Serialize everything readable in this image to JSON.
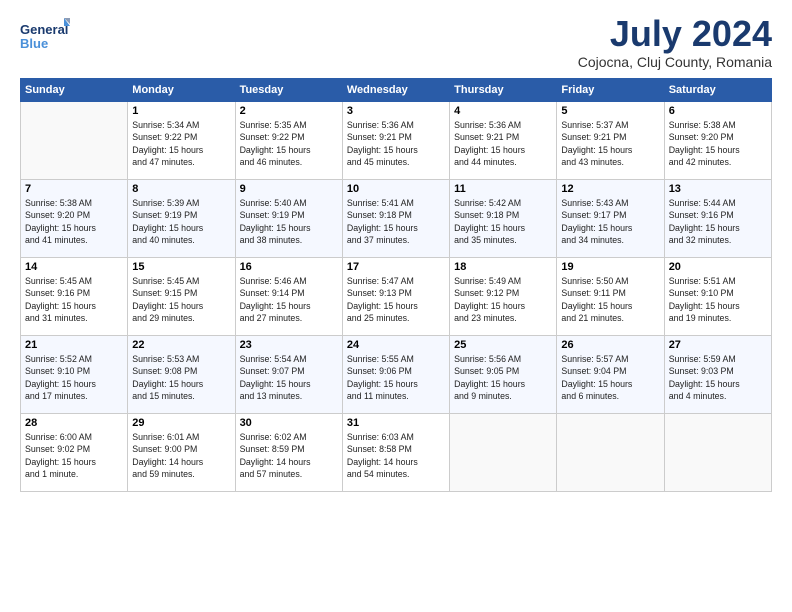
{
  "header": {
    "logo_general": "General",
    "logo_blue": "Blue",
    "month_title": "July 2024",
    "location": "Cojocna, Cluj County, Romania"
  },
  "days_of_week": [
    "Sunday",
    "Monday",
    "Tuesday",
    "Wednesday",
    "Thursday",
    "Friday",
    "Saturday"
  ],
  "weeks": [
    [
      {
        "day": "",
        "info": ""
      },
      {
        "day": "1",
        "info": "Sunrise: 5:34 AM\nSunset: 9:22 PM\nDaylight: 15 hours\nand 47 minutes."
      },
      {
        "day": "2",
        "info": "Sunrise: 5:35 AM\nSunset: 9:22 PM\nDaylight: 15 hours\nand 46 minutes."
      },
      {
        "day": "3",
        "info": "Sunrise: 5:36 AM\nSunset: 9:21 PM\nDaylight: 15 hours\nand 45 minutes."
      },
      {
        "day": "4",
        "info": "Sunrise: 5:36 AM\nSunset: 9:21 PM\nDaylight: 15 hours\nand 44 minutes."
      },
      {
        "day": "5",
        "info": "Sunrise: 5:37 AM\nSunset: 9:21 PM\nDaylight: 15 hours\nand 43 minutes."
      },
      {
        "day": "6",
        "info": "Sunrise: 5:38 AM\nSunset: 9:20 PM\nDaylight: 15 hours\nand 42 minutes."
      }
    ],
    [
      {
        "day": "7",
        "info": "Sunrise: 5:38 AM\nSunset: 9:20 PM\nDaylight: 15 hours\nand 41 minutes."
      },
      {
        "day": "8",
        "info": "Sunrise: 5:39 AM\nSunset: 9:19 PM\nDaylight: 15 hours\nand 40 minutes."
      },
      {
        "day": "9",
        "info": "Sunrise: 5:40 AM\nSunset: 9:19 PM\nDaylight: 15 hours\nand 38 minutes."
      },
      {
        "day": "10",
        "info": "Sunrise: 5:41 AM\nSunset: 9:18 PM\nDaylight: 15 hours\nand 37 minutes."
      },
      {
        "day": "11",
        "info": "Sunrise: 5:42 AM\nSunset: 9:18 PM\nDaylight: 15 hours\nand 35 minutes."
      },
      {
        "day": "12",
        "info": "Sunrise: 5:43 AM\nSunset: 9:17 PM\nDaylight: 15 hours\nand 34 minutes."
      },
      {
        "day": "13",
        "info": "Sunrise: 5:44 AM\nSunset: 9:16 PM\nDaylight: 15 hours\nand 32 minutes."
      }
    ],
    [
      {
        "day": "14",
        "info": "Sunrise: 5:45 AM\nSunset: 9:16 PM\nDaylight: 15 hours\nand 31 minutes."
      },
      {
        "day": "15",
        "info": "Sunrise: 5:45 AM\nSunset: 9:15 PM\nDaylight: 15 hours\nand 29 minutes."
      },
      {
        "day": "16",
        "info": "Sunrise: 5:46 AM\nSunset: 9:14 PM\nDaylight: 15 hours\nand 27 minutes."
      },
      {
        "day": "17",
        "info": "Sunrise: 5:47 AM\nSunset: 9:13 PM\nDaylight: 15 hours\nand 25 minutes."
      },
      {
        "day": "18",
        "info": "Sunrise: 5:49 AM\nSunset: 9:12 PM\nDaylight: 15 hours\nand 23 minutes."
      },
      {
        "day": "19",
        "info": "Sunrise: 5:50 AM\nSunset: 9:11 PM\nDaylight: 15 hours\nand 21 minutes."
      },
      {
        "day": "20",
        "info": "Sunrise: 5:51 AM\nSunset: 9:10 PM\nDaylight: 15 hours\nand 19 minutes."
      }
    ],
    [
      {
        "day": "21",
        "info": "Sunrise: 5:52 AM\nSunset: 9:10 PM\nDaylight: 15 hours\nand 17 minutes."
      },
      {
        "day": "22",
        "info": "Sunrise: 5:53 AM\nSunset: 9:08 PM\nDaylight: 15 hours\nand 15 minutes."
      },
      {
        "day": "23",
        "info": "Sunrise: 5:54 AM\nSunset: 9:07 PM\nDaylight: 15 hours\nand 13 minutes."
      },
      {
        "day": "24",
        "info": "Sunrise: 5:55 AM\nSunset: 9:06 PM\nDaylight: 15 hours\nand 11 minutes."
      },
      {
        "day": "25",
        "info": "Sunrise: 5:56 AM\nSunset: 9:05 PM\nDaylight: 15 hours\nand 9 minutes."
      },
      {
        "day": "26",
        "info": "Sunrise: 5:57 AM\nSunset: 9:04 PM\nDaylight: 15 hours\nand 6 minutes."
      },
      {
        "day": "27",
        "info": "Sunrise: 5:59 AM\nSunset: 9:03 PM\nDaylight: 15 hours\nand 4 minutes."
      }
    ],
    [
      {
        "day": "28",
        "info": "Sunrise: 6:00 AM\nSunset: 9:02 PM\nDaylight: 15 hours\nand 1 minute."
      },
      {
        "day": "29",
        "info": "Sunrise: 6:01 AM\nSunset: 9:00 PM\nDaylight: 14 hours\nand 59 minutes."
      },
      {
        "day": "30",
        "info": "Sunrise: 6:02 AM\nSunset: 8:59 PM\nDaylight: 14 hours\nand 57 minutes."
      },
      {
        "day": "31",
        "info": "Sunrise: 6:03 AM\nSunset: 8:58 PM\nDaylight: 14 hours\nand 54 minutes."
      },
      {
        "day": "",
        "info": ""
      },
      {
        "day": "",
        "info": ""
      },
      {
        "day": "",
        "info": ""
      }
    ]
  ]
}
